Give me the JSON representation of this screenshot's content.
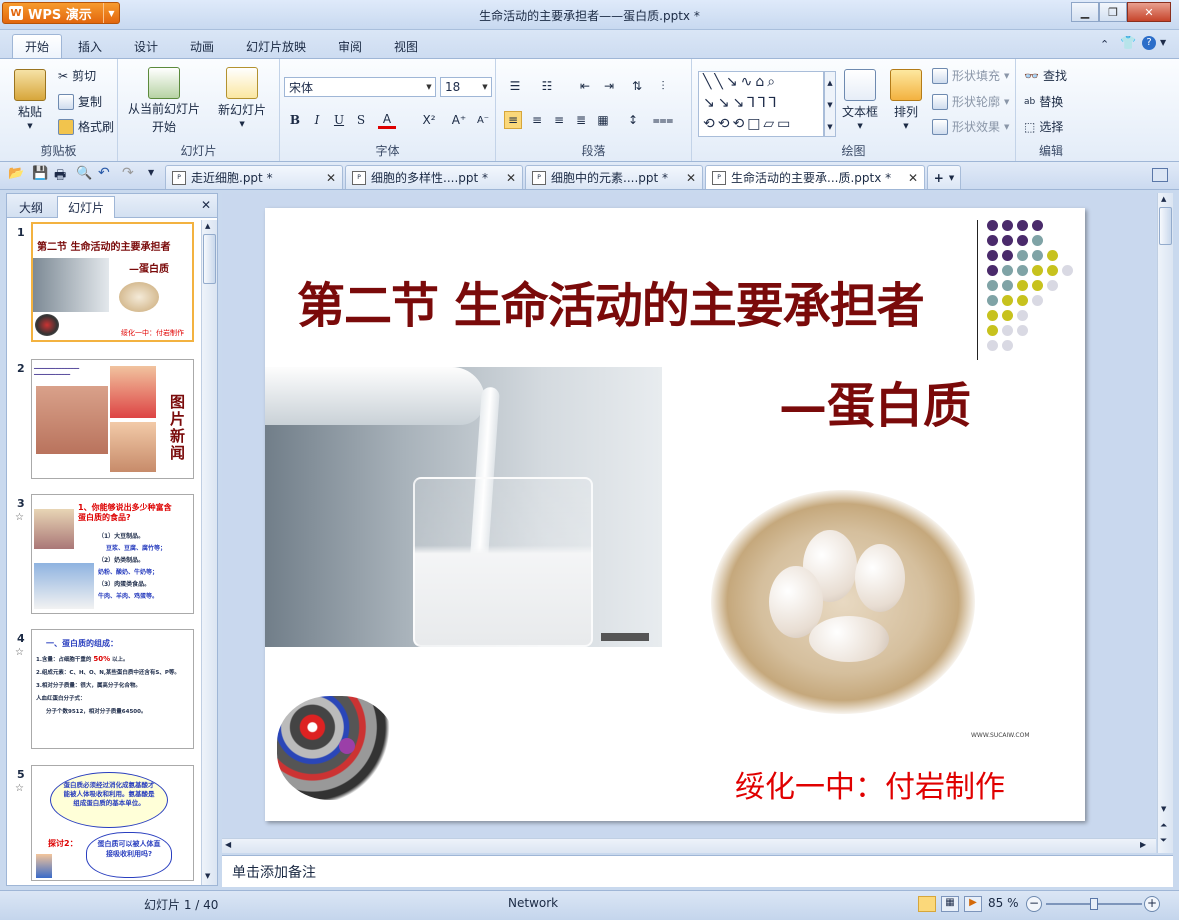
{
  "window": {
    "app_button": "WPS 演示",
    "title": "生命活动的主要承担者——蛋白质.pptx *"
  },
  "menu": {
    "tabs": [
      "开始",
      "插入",
      "设计",
      "动画",
      "幻灯片放映",
      "审阅",
      "视图"
    ],
    "active_tab": "开始"
  },
  "ribbon": {
    "clipboard": {
      "label": "剪贴板",
      "paste": "粘贴",
      "cut": "剪切",
      "copy": "复制",
      "format_painter": "格式刷"
    },
    "slideshow": {
      "label": "幻灯片",
      "from_current": "从当前幻灯片",
      "from_current_2": "开始",
      "new_slide": "新幻灯片"
    },
    "font": {
      "label": "字体",
      "font_name": "宋体",
      "font_size": "18",
      "bold": "B",
      "italic": "I",
      "underline": "U",
      "shadow": "S"
    },
    "paragraph": {
      "label": "段落"
    },
    "drawing": {
      "label": "绘图",
      "textbox": "文本框",
      "arrange": "排列",
      "shape_fill": "形状填充",
      "shape_outline": "形状轮廓",
      "shape_effects": "形状效果"
    },
    "editing": {
      "label": "编辑",
      "find": "查找",
      "replace": "替换",
      "select": "选择"
    }
  },
  "doc_tabs": [
    {
      "name": "走近细胞.ppt *"
    },
    {
      "name": "细胞的多样性....ppt *"
    },
    {
      "name": "细胞中的元素....ppt *"
    },
    {
      "name": "生命活动的主要承...质.pptx *"
    }
  ],
  "left_pane": {
    "tabs": [
      "大纲",
      "幻灯片"
    ],
    "active_tab": "幻灯片",
    "thumbnails": [
      {
        "num": "1",
        "title": "第二节 生命活动的主要承担者",
        "sub": "—蛋白质",
        "footer": "绥化一中：付岩制作"
      },
      {
        "num": "2",
        "text": "图片新闻"
      },
      {
        "num": "3",
        "head": "1、你能够说出多少种富含蛋白质的食品?",
        "l1": "（1）大豆制品。",
        "l2": "豆浆、豆腐、腐竹等；",
        "l3": "（2）奶类制品。",
        "l4": "奶粉、酸奶、牛奶等；",
        "l5": "（3）肉蛋类食品。",
        "l6": "牛肉、羊肉、鸡蛋等。"
      },
      {
        "num": "4",
        "head": "一、蛋白质的组成：",
        "l1": "1.含量：占细胞干重的",
        "pct": "50%",
        "l1b": "以上。",
        "l2": "2.组成元素：C、H、O、N,某些蛋白质中还含有S、P等。",
        "l3": "3.相对分子质量：很大，属高分子化合物。",
        "l4": "人血红蛋白分子式：",
        "l5": "分子个数9512，相对分子质量64500。"
      },
      {
        "num": "5",
        "bubble1": "蛋白质必须经过消化成氨基酸才能被人体吸收和利用。氨基酸是组成蛋白质的基本单位。",
        "probe": "探讨2：",
        "bubble2": "蛋白质可以被人体直接吸收利用吗?"
      }
    ]
  },
  "slide": {
    "title": "第二节 生命活动的主要承担者",
    "subtitle": "—蛋白质",
    "footer": "绥化一中：付岩制作",
    "watermark": "WWW.SUCAIW.COM"
  },
  "notes": {
    "placeholder": "单击添加备注"
  },
  "status": {
    "slide_info": "幻灯片 1 / 40",
    "theme": "Network",
    "zoom": "85 %"
  },
  "colors": {
    "title": "#7a0a0a",
    "footer": "#e00000",
    "accent": "#f3b240"
  }
}
